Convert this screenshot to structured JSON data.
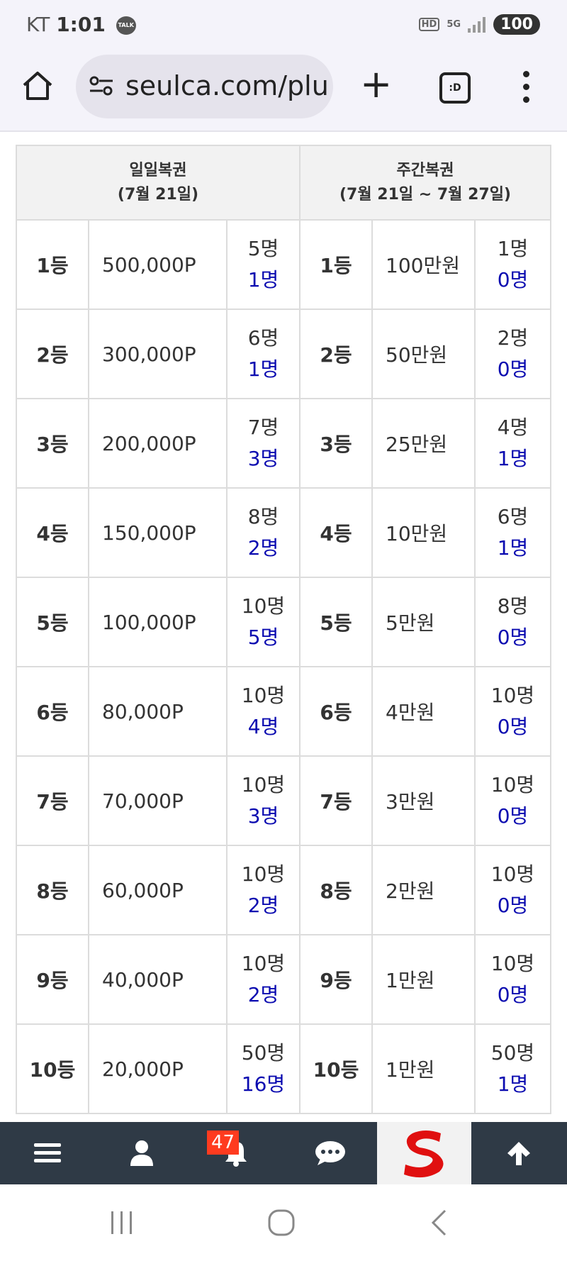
{
  "status_bar": {
    "carrier": "KT",
    "time": "1:01",
    "talk_badge": "TALK",
    "hd_label": "HD",
    "network_label": "5G",
    "battery": "100"
  },
  "browser": {
    "url": "seulca.com/plu",
    "tabs_label": ":D"
  },
  "table": {
    "daily_header": {
      "line1": "일일복권",
      "line2": "(7월 21일)"
    },
    "weekly_header": {
      "line1": "주간복권",
      "line2": "(7월 21일 ~ 7월 27일)"
    },
    "rows": [
      {
        "rank": "1등",
        "daily_prize": "500,000P",
        "daily_count": "5명",
        "daily_winners": "1명",
        "weekly_prize": "100만원",
        "weekly_count": "1명",
        "weekly_winners": "0명"
      },
      {
        "rank": "2등",
        "daily_prize": "300,000P",
        "daily_count": "6명",
        "daily_winners": "1명",
        "weekly_prize": "50만원",
        "weekly_count": "2명",
        "weekly_winners": "0명"
      },
      {
        "rank": "3등",
        "daily_prize": "200,000P",
        "daily_count": "7명",
        "daily_winners": "3명",
        "weekly_prize": "25만원",
        "weekly_count": "4명",
        "weekly_winners": "1명"
      },
      {
        "rank": "4등",
        "daily_prize": "150,000P",
        "daily_count": "8명",
        "daily_winners": "2명",
        "weekly_prize": "10만원",
        "weekly_count": "6명",
        "weekly_winners": "1명"
      },
      {
        "rank": "5등",
        "daily_prize": "100,000P",
        "daily_count": "10명",
        "daily_winners": "5명",
        "weekly_prize": "5만원",
        "weekly_count": "8명",
        "weekly_winners": "0명"
      },
      {
        "rank": "6등",
        "daily_prize": "80,000P",
        "daily_count": "10명",
        "daily_winners": "4명",
        "weekly_prize": "4만원",
        "weekly_count": "10명",
        "weekly_winners": "0명"
      },
      {
        "rank": "7등",
        "daily_prize": "70,000P",
        "daily_count": "10명",
        "daily_winners": "3명",
        "weekly_prize": "3만원",
        "weekly_count": "10명",
        "weekly_winners": "0명"
      },
      {
        "rank": "8등",
        "daily_prize": "60,000P",
        "daily_count": "10명",
        "daily_winners": "2명",
        "weekly_prize": "2만원",
        "weekly_count": "10명",
        "weekly_winners": "0명"
      },
      {
        "rank": "9등",
        "daily_prize": "40,000P",
        "daily_count": "10명",
        "daily_winners": "2명",
        "weekly_prize": "1만원",
        "weekly_count": "10명",
        "weekly_winners": "0명"
      },
      {
        "rank": "10등",
        "daily_prize": "20,000P",
        "daily_count": "50명",
        "daily_winners": "16명",
        "weekly_prize": "1만원",
        "weekly_count": "50명",
        "weekly_winners": "1명"
      }
    ]
  },
  "bottom_nav": {
    "notification_count": "47",
    "icons": [
      "menu-icon",
      "user-icon",
      "bell-icon",
      "chat-icon",
      "site-logo",
      "arrow-up-icon"
    ]
  },
  "colors": {
    "winner_count": "#0a0ab0",
    "nav_bg": "#2f3a46",
    "badge_bg": "#ff3b1f",
    "logo_red": "#e01010"
  }
}
